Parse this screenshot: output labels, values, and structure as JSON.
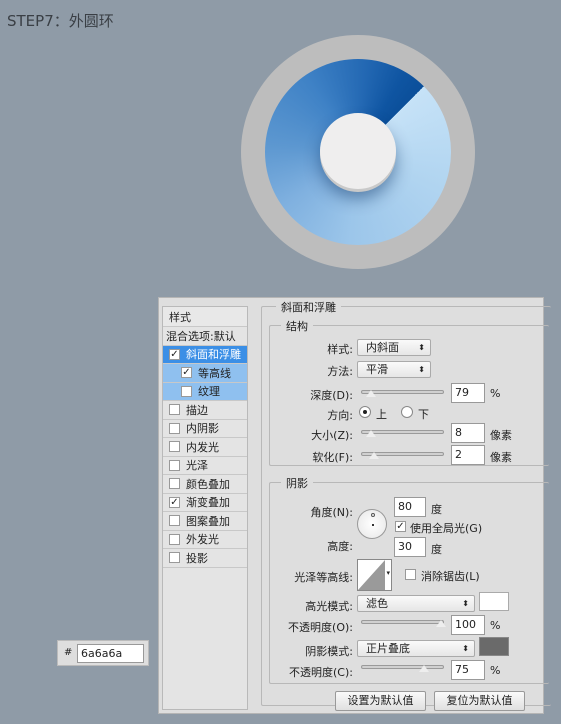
{
  "title": "STEP7：外圆环",
  "hex": {
    "prefix": "#",
    "value": "6a6a6a"
  },
  "styles_list": {
    "header": "样式",
    "blend": "混合选项:默认",
    "items": [
      {
        "label": "斜面和浮雕",
        "checked": true,
        "state": "selected"
      },
      {
        "label": "等高线",
        "checked": true,
        "state": "sub"
      },
      {
        "label": "纹理",
        "checked": false,
        "state": "sub"
      },
      {
        "label": "描边",
        "checked": false
      },
      {
        "label": "内阴影",
        "checked": false
      },
      {
        "label": "内发光",
        "checked": false
      },
      {
        "label": "光泽",
        "checked": false
      },
      {
        "label": "颜色叠加",
        "checked": false
      },
      {
        "label": "渐变叠加",
        "checked": true
      },
      {
        "label": "图案叠加",
        "checked": false
      },
      {
        "label": "外发光",
        "checked": false
      },
      {
        "label": "投影",
        "checked": false
      }
    ]
  },
  "bevel": {
    "title": "斜面和浮雕",
    "structure": {
      "title": "结构",
      "style_label": "样式:",
      "style_value": "内斜面",
      "method_label": "方法:",
      "method_value": "平滑",
      "depth_label": "深度(D):",
      "depth_value": "79",
      "depth_unit": "%",
      "direction_label": "方向:",
      "dir_up": "上",
      "dir_down": "下",
      "direction_selected": "上",
      "size_label": "大小(Z):",
      "size_value": "8",
      "size_unit": "像素",
      "soften_label": "软化(F):",
      "soften_value": "2",
      "soften_unit": "像素"
    },
    "shading": {
      "title": "阴影",
      "angle_label": "角度(N):",
      "angle_value": "80",
      "angle_unit": "度",
      "global_light": "使用全局光(G)",
      "global_light_checked": true,
      "altitude_label": "高度:",
      "altitude_value": "30",
      "altitude_unit": "度",
      "gloss_label": "光泽等高线:",
      "antialias": "消除锯齿(L)",
      "antialias_checked": false,
      "highlight_label": "高光模式:",
      "highlight_mode": "滤色",
      "highlight_color": "#ffffff",
      "hl_opacity_label": "不透明度(O):",
      "hl_opacity": "100",
      "pct": "%",
      "shadow_label": "阴影模式:",
      "shadow_mode": "正片叠底",
      "shadow_color": "#6a6a6a",
      "sh_opacity_label": "不透明度(C):",
      "sh_opacity": "75"
    }
  },
  "buttons": {
    "set_default": "设置为默认值",
    "reset_default": "复位为默认值"
  }
}
